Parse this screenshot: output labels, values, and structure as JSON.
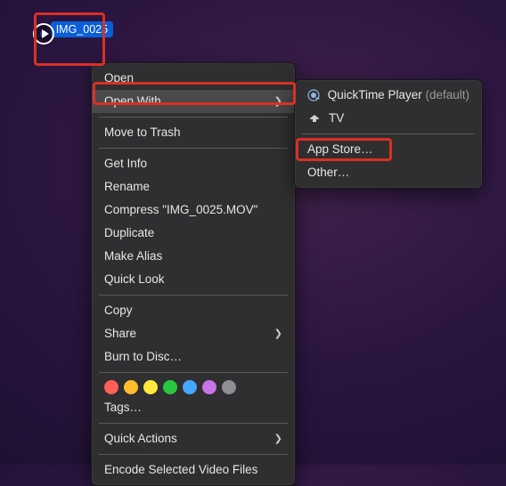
{
  "file": {
    "name": "IMG_0025"
  },
  "menu": {
    "open": "Open",
    "open_with": "Open With",
    "move_to_trash": "Move to Trash",
    "get_info": "Get Info",
    "rename": "Rename",
    "compress": "Compress \"IMG_0025.MOV\"",
    "duplicate": "Duplicate",
    "make_alias": "Make Alias",
    "quick_look": "Quick Look",
    "copy": "Copy",
    "share": "Share",
    "burn_to_disc": "Burn to Disc…",
    "tags": "Tags…",
    "quick_actions": "Quick Actions",
    "encode": "Encode Selected Video Files"
  },
  "submenu": {
    "quicktime": "QuickTime Player",
    "quicktime_suffix": " (default)",
    "tv": "TV",
    "app_store": "App Store…",
    "other": "Other…"
  },
  "tag_colors": [
    "#ff5f57",
    "#ffbd2e",
    "#ffe83b",
    "#28c840",
    "#45a7ff",
    "#c774e8",
    "#8e8e93"
  ]
}
